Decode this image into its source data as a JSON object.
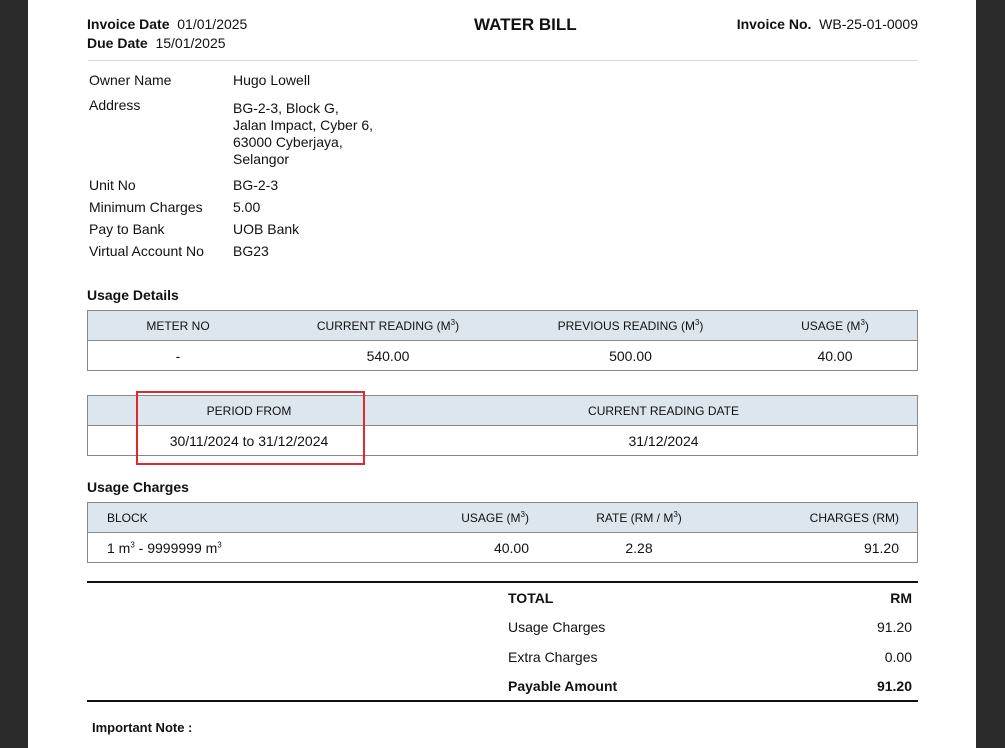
{
  "header": {
    "invoice_date_label": "Invoice Date",
    "invoice_date": "01/01/2025",
    "due_date_label": "Due Date",
    "due_date": "15/01/2025",
    "title": "WATER BILL",
    "invoice_no_label": "Invoice No.",
    "invoice_no": "WB-25-01-0009"
  },
  "owner": {
    "owner_name_label": "Owner Name",
    "owner_name": "Hugo Lowell",
    "address_label": "Address",
    "address_lines": [
      "BG-2-3, Block G,",
      "Jalan Impact, Cyber 6,",
      "63000 Cyberjaya,",
      "Selangor"
    ],
    "unit_no_label": "Unit No",
    "unit_no": "BG-2-3",
    "min_charges_label": "Minimum Charges",
    "min_charges": "5.00",
    "pay_to_bank_label": "Pay to Bank",
    "pay_to_bank": "UOB Bank",
    "virtual_account_label": "Virtual Account No",
    "virtual_account": "BG23"
  },
  "usage_details": {
    "title": "Usage Details",
    "headers": {
      "meter_no": "METER NO",
      "current_reading": "CURRENT READING (M",
      "previous_reading": "PREVIOUS READING (M",
      "usage": "USAGE (M",
      "unit_sup": "3",
      "close_paren": ")"
    },
    "row": {
      "meter_no": "-",
      "current_reading": "540.00",
      "previous_reading": "500.00",
      "usage": "40.00"
    }
  },
  "period": {
    "headers": {
      "period_from": "PERIOD FROM",
      "current_reading_date": "CURRENT READING DATE"
    },
    "row": {
      "period_from": "30/11/2024 to 31/12/2024",
      "current_reading_date": "31/12/2024"
    }
  },
  "usage_charges": {
    "title": "Usage Charges",
    "headers": {
      "block": "BLOCK",
      "usage": "USAGE (M",
      "rate": "RATE (RM / M",
      "charges": "CHARGES (RM)",
      "unit_sup": "3",
      "close_paren": ")"
    },
    "row": {
      "block_start": "1 m",
      "block_mid": " - 9999999 m",
      "unit_sup": "3",
      "usage": "40.00",
      "rate": "2.28",
      "charges": "91.20"
    }
  },
  "totals": {
    "total_label": "TOTAL",
    "currency": "RM",
    "usage_charges_label": "Usage Charges",
    "usage_charges": "91.20",
    "extra_charges_label": "Extra Charges",
    "extra_charges": "0.00",
    "payable_label": "Payable Amount",
    "payable": "91.20"
  },
  "note": {
    "label": "Important Note :"
  }
}
